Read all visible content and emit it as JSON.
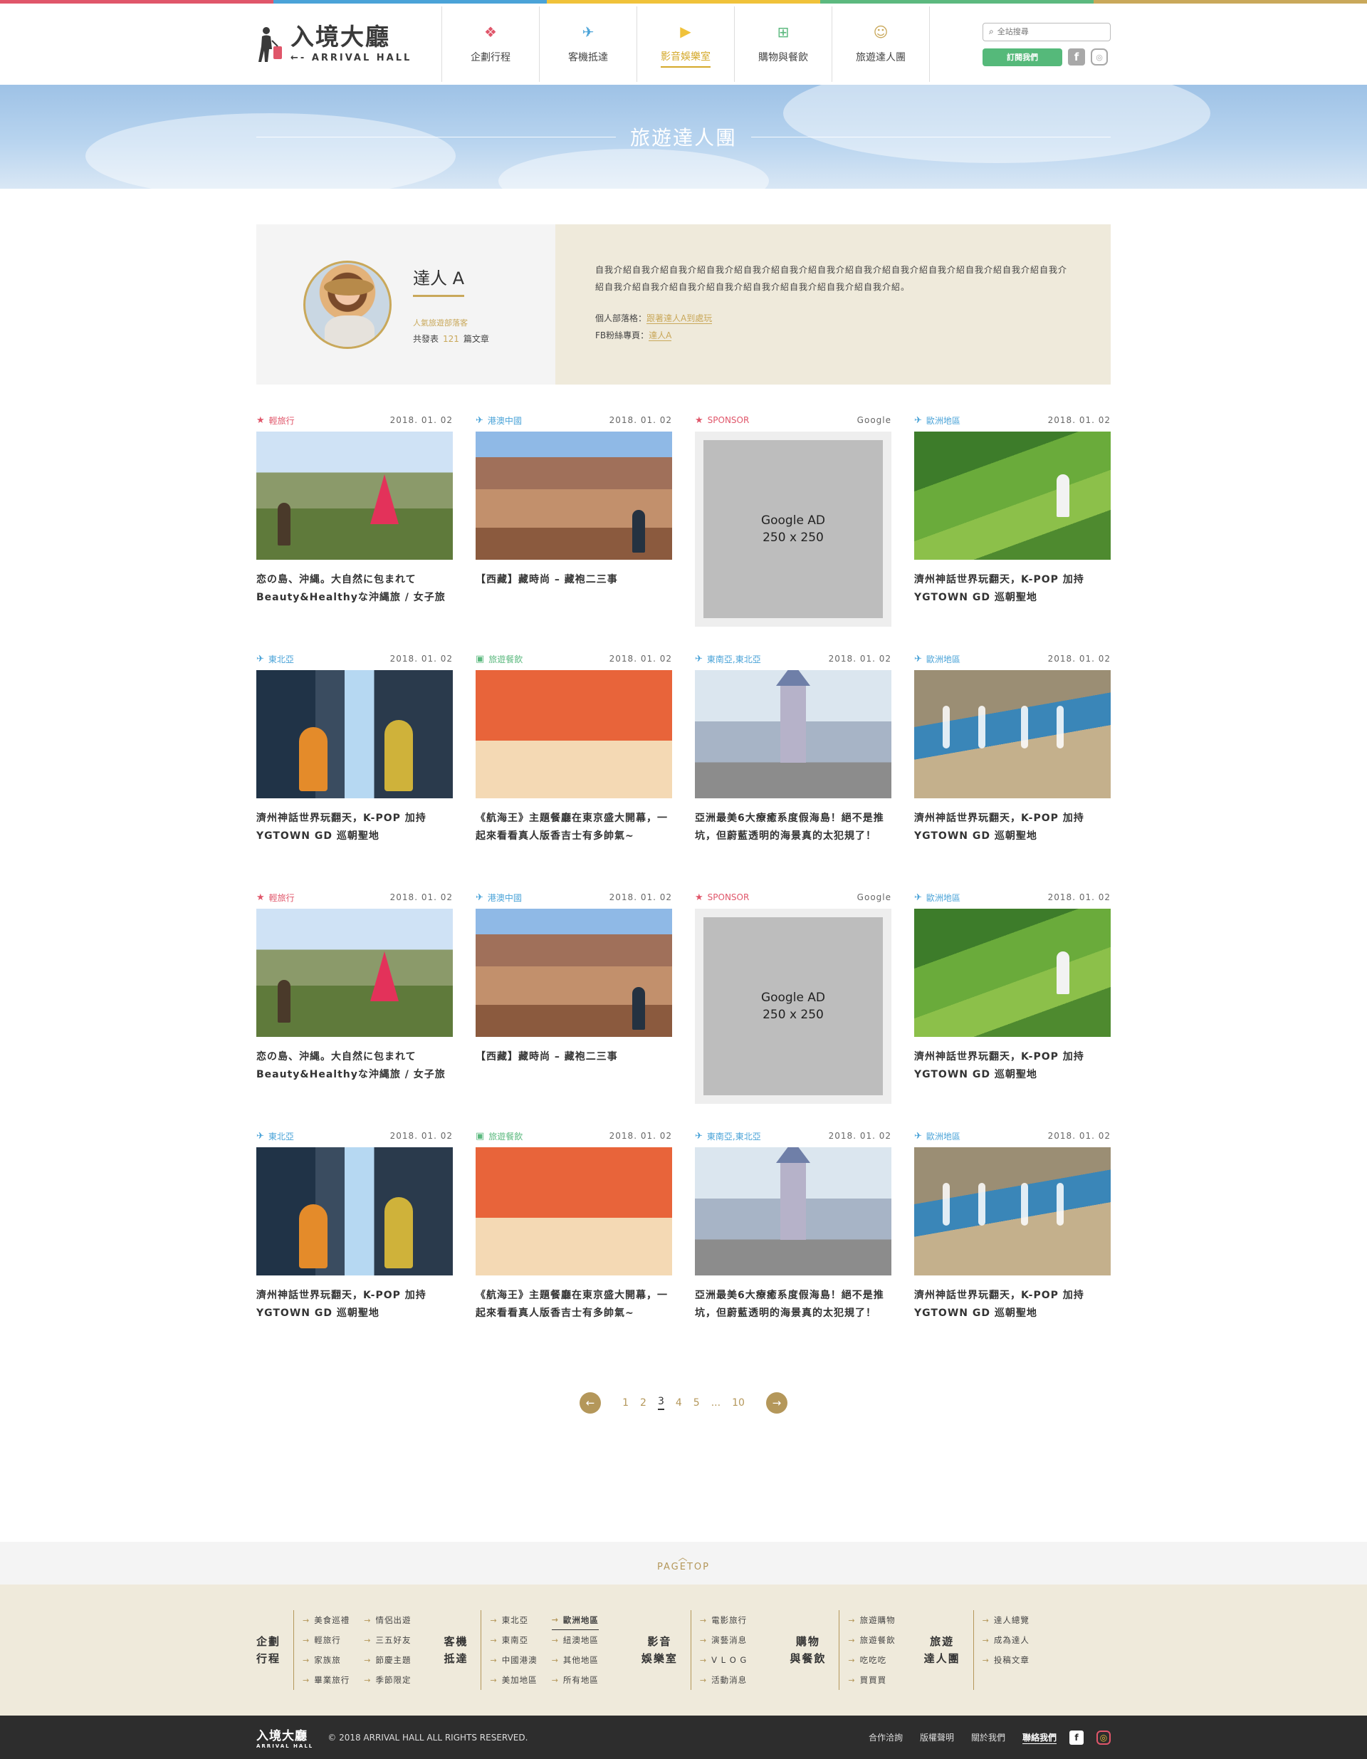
{
  "colors": {
    "strip": [
      "#e0566a",
      "#4aa3d8",
      "#f0c23a",
      "#5cb97f",
      "#c9a85a"
    ],
    "gold": "#c9a85a",
    "green": "#55b97a"
  },
  "header": {
    "logo_cn": "入境大廳",
    "logo_en": "ARRIVAL HALL",
    "nav": [
      {
        "label": "企劃行程",
        "icon": "calendar-star-icon",
        "color": "#e0566a"
      },
      {
        "label": "客機抵達",
        "icon": "plane-icon",
        "color": "#4aa3d8"
      },
      {
        "label": "影音娛樂室",
        "icon": "play-screen-icon",
        "color": "#f0c23a",
        "active": true
      },
      {
        "label": "購物與餐飲",
        "icon": "basket-icon",
        "color": "#5cb97f"
      },
      {
        "label": "旅遊達人團",
        "icon": "chat-face-icon",
        "color": "#c9a85a"
      }
    ],
    "search_placeholder": "全站搜尋",
    "subscribe_label": "訂閱我們"
  },
  "banner": {
    "title": "旅遊達人團"
  },
  "profile": {
    "name": "達人 A",
    "tag": "人氣旅遊部落客",
    "count_prefix": "共發表",
    "count": "121",
    "count_suffix": "篇文章",
    "intro": "自我介紹自我介紹自我介紹自我介紹自我介紹自我介紹自我介紹自我介紹自我介紹自我介紹自我介紹自我介紹自我介紹自我介紹自我介紹自我介紹自我介紹自我介紹自我介紹自我介紹自我介紹。",
    "blog_label": "個人部落格：",
    "blog_link": "跟著達人A到處玩",
    "fb_label": "FB粉絲專頁：",
    "fb_link": "達人A"
  },
  "cards": [
    {
      "cat": "輕旅行",
      "cat_color": "#e0566a",
      "cat_icon": "★",
      "date": "2018. 01. 02",
      "title": "恋の島、沖縄。大自然に包まれてBeauty&Healthyな沖縄旅 / 女子旅",
      "scene": "ruin"
    },
    {
      "cat": "港澳中國",
      "cat_color": "#4aa3d8",
      "cat_icon": "✈",
      "date": "2018. 01. 02",
      "title": "【西藏】藏時尚 – 藏袍二三事",
      "scene": "canyon"
    },
    {
      "cat": "SPONSOR",
      "cat_color": "#e0566a",
      "cat_icon": "★",
      "date": "Google",
      "ad": [
        "Google AD",
        "250 x 250"
      ]
    },
    {
      "cat": "歐洲地區",
      "cat_color": "#4aa3d8",
      "cat_icon": "✈",
      "date": "2018. 01. 02",
      "title": "濟州神話世界玩翻天，K-POP 加持YGTOWN GD 巡朝聖地",
      "scene": "terrace"
    },
    {
      "cat": "東北亞",
      "cat_color": "#4aa3d8",
      "cat_icon": "✈",
      "date": "2018. 01. 02",
      "title": "濟州神話世界玩翻天，K-POP 加持YGTOWN GD 巡朝聖地",
      "scene": "room"
    },
    {
      "cat": "旅遊餐飲",
      "cat_color": "#5cb97f",
      "cat_icon": "▣",
      "date": "2018. 01. 02",
      "title": "《航海王》主題餐廳在東京盛大開幕，一起來看看真人版香吉士有多帥氣~",
      "scene": "food"
    },
    {
      "cat": "東南亞,東北亞",
      "cat_color": "#4aa3d8",
      "cat_icon": "✈",
      "date": "2018. 01. 02",
      "title": "亞洲最美6大療癒系度假海島！絕不是推坑，但蔚藍透明的海景真的太犯規了！",
      "scene": "castle"
    },
    {
      "cat": "歐洲地區",
      "cat_color": "#4aa3d8",
      "cat_icon": "✈",
      "date": "2018. 01. 02",
      "title": "濟州神話世界玩翻天，K-POP 加持YGTOWN GD 巡朝聖地",
      "scene": "city"
    },
    {
      "cat": "輕旅行",
      "cat_color": "#e0566a",
      "cat_icon": "★",
      "date": "2018. 01. 02",
      "title": "恋の島、沖縄。大自然に包まれてBeauty&Healthyな沖縄旅 / 女子旅",
      "scene": "ruin"
    },
    {
      "cat": "港澳中國",
      "cat_color": "#4aa3d8",
      "cat_icon": "✈",
      "date": "2018. 01. 02",
      "title": "【西藏】藏時尚 – 藏袍二三事",
      "scene": "canyon"
    },
    {
      "cat": "SPONSOR",
      "cat_color": "#e0566a",
      "cat_icon": "★",
      "date": "Google",
      "ad": [
        "Google AD",
        "250 x 250"
      ]
    },
    {
      "cat": "歐洲地區",
      "cat_color": "#4aa3d8",
      "cat_icon": "✈",
      "date": "2018. 01. 02",
      "title": "濟州神話世界玩翻天，K-POP 加持YGTOWN GD 巡朝聖地",
      "scene": "terrace"
    },
    {
      "cat": "東北亞",
      "cat_color": "#4aa3d8",
      "cat_icon": "✈",
      "date": "2018. 01. 02",
      "title": "濟州神話世界玩翻天，K-POP 加持YGTOWN GD 巡朝聖地",
      "scene": "room"
    },
    {
      "cat": "旅遊餐飲",
      "cat_color": "#5cb97f",
      "cat_icon": "▣",
      "date": "2018. 01. 02",
      "title": "《航海王》主題餐廳在東京盛大開幕，一起來看看真人版香吉士有多帥氣~",
      "scene": "food"
    },
    {
      "cat": "東南亞,東北亞",
      "cat_color": "#4aa3d8",
      "cat_icon": "✈",
      "date": "2018. 01. 02",
      "title": "亞洲最美6大療癒系度假海島！絕不是推坑，但蔚藍透明的海景真的太犯規了！",
      "scene": "castle"
    },
    {
      "cat": "歐洲地區",
      "cat_color": "#4aa3d8",
      "cat_icon": "✈",
      "date": "2018. 01. 02",
      "title": "濟州神話世界玩翻天，K-POP 加持YGTOWN GD 巡朝聖地",
      "scene": "city"
    }
  ],
  "pagination": {
    "pages": [
      "1",
      "2",
      "3",
      "4",
      "5",
      "...",
      "10"
    ],
    "current": "3"
  },
  "pagetop": "PAGETOP",
  "footer_nav": [
    {
      "title": [
        "企劃",
        "行程"
      ],
      "links": [
        "美食巡禮",
        "輕旅行",
        "家族旅",
        "畢業旅行",
        "情侶出遊",
        "三五好友",
        "節慶主題",
        "季節限定"
      ]
    },
    {
      "title": [
        "客機",
        "抵達"
      ],
      "links": [
        "東北亞",
        "東南亞",
        "中國港澳",
        "美加地區",
        "歐洲地區",
        "紐澳地區",
        "其他地區",
        "所有地區"
      ],
      "highlight": "歐洲地區"
    },
    {
      "title": [
        "影音",
        "娛樂室"
      ],
      "links": [
        "電影旅行",
        "演藝消息",
        "V L O G",
        "活動消息"
      ]
    },
    {
      "title": [
        "購物",
        "與餐飲"
      ],
      "links": [
        "旅遊購物",
        "旅遊餐飲",
        "吃吃吃",
        "買買買"
      ]
    },
    {
      "title": [
        "旅遊",
        "達人團"
      ],
      "links": [
        "達人總覽",
        "成為達人",
        "投稿文章"
      ]
    }
  ],
  "footer": {
    "logo_cn": "入境大廳",
    "logo_en": "ARRIVAL HALL",
    "copyright": "© 2018 ARRIVAL HALL ALL RIGHTS RESERVED.",
    "links": [
      "合作洽詢",
      "版權聲明",
      "關於我們",
      "聯絡我們"
    ],
    "bold_link": "聯絡我們"
  }
}
